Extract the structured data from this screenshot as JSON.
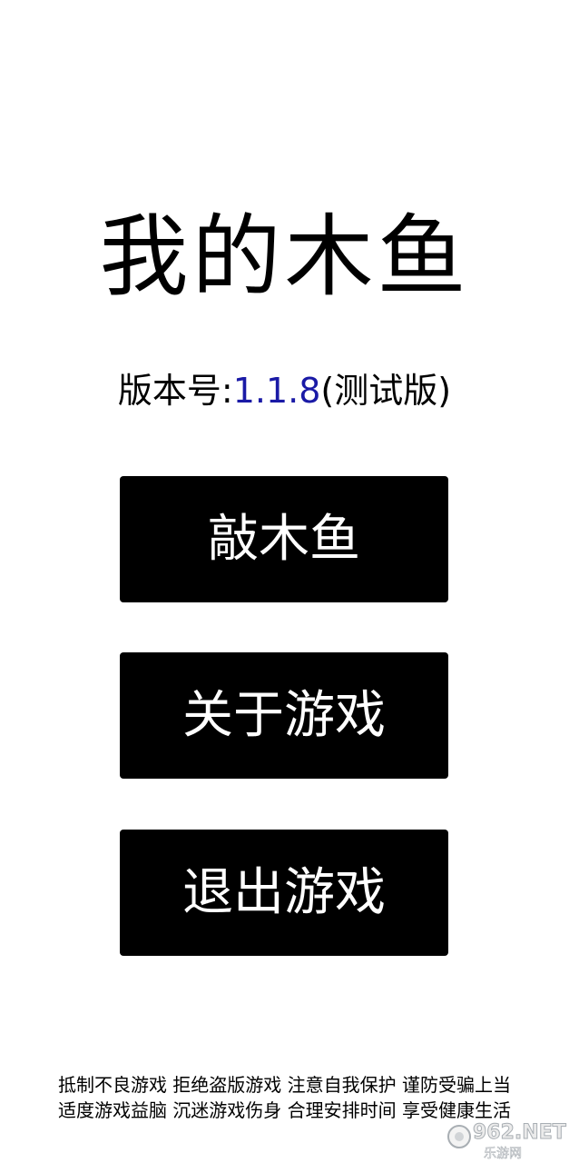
{
  "app": {
    "title": "我的木鱼",
    "version_label": "版本号:",
    "version_number": "1.1.8",
    "version_suffix": "(测试版)"
  },
  "menu": {
    "start_label": "敲木鱼",
    "about_label": "关于游戏",
    "exit_label": "退出游戏"
  },
  "footer": {
    "line1": "抵制不良游戏 拒绝盗版游戏 注意自我保护 谨防受骗上当",
    "line2": "适度游戏益脑 沉迷游戏伤身 合理安排时间 享受健康生活"
  },
  "watermark": {
    "text": "962.NET",
    "subtext": "乐游网"
  },
  "colors": {
    "background": "#ffffff",
    "button_bg": "#000000",
    "button_text": "#ffffff",
    "version_number": "#1a1aa6"
  }
}
